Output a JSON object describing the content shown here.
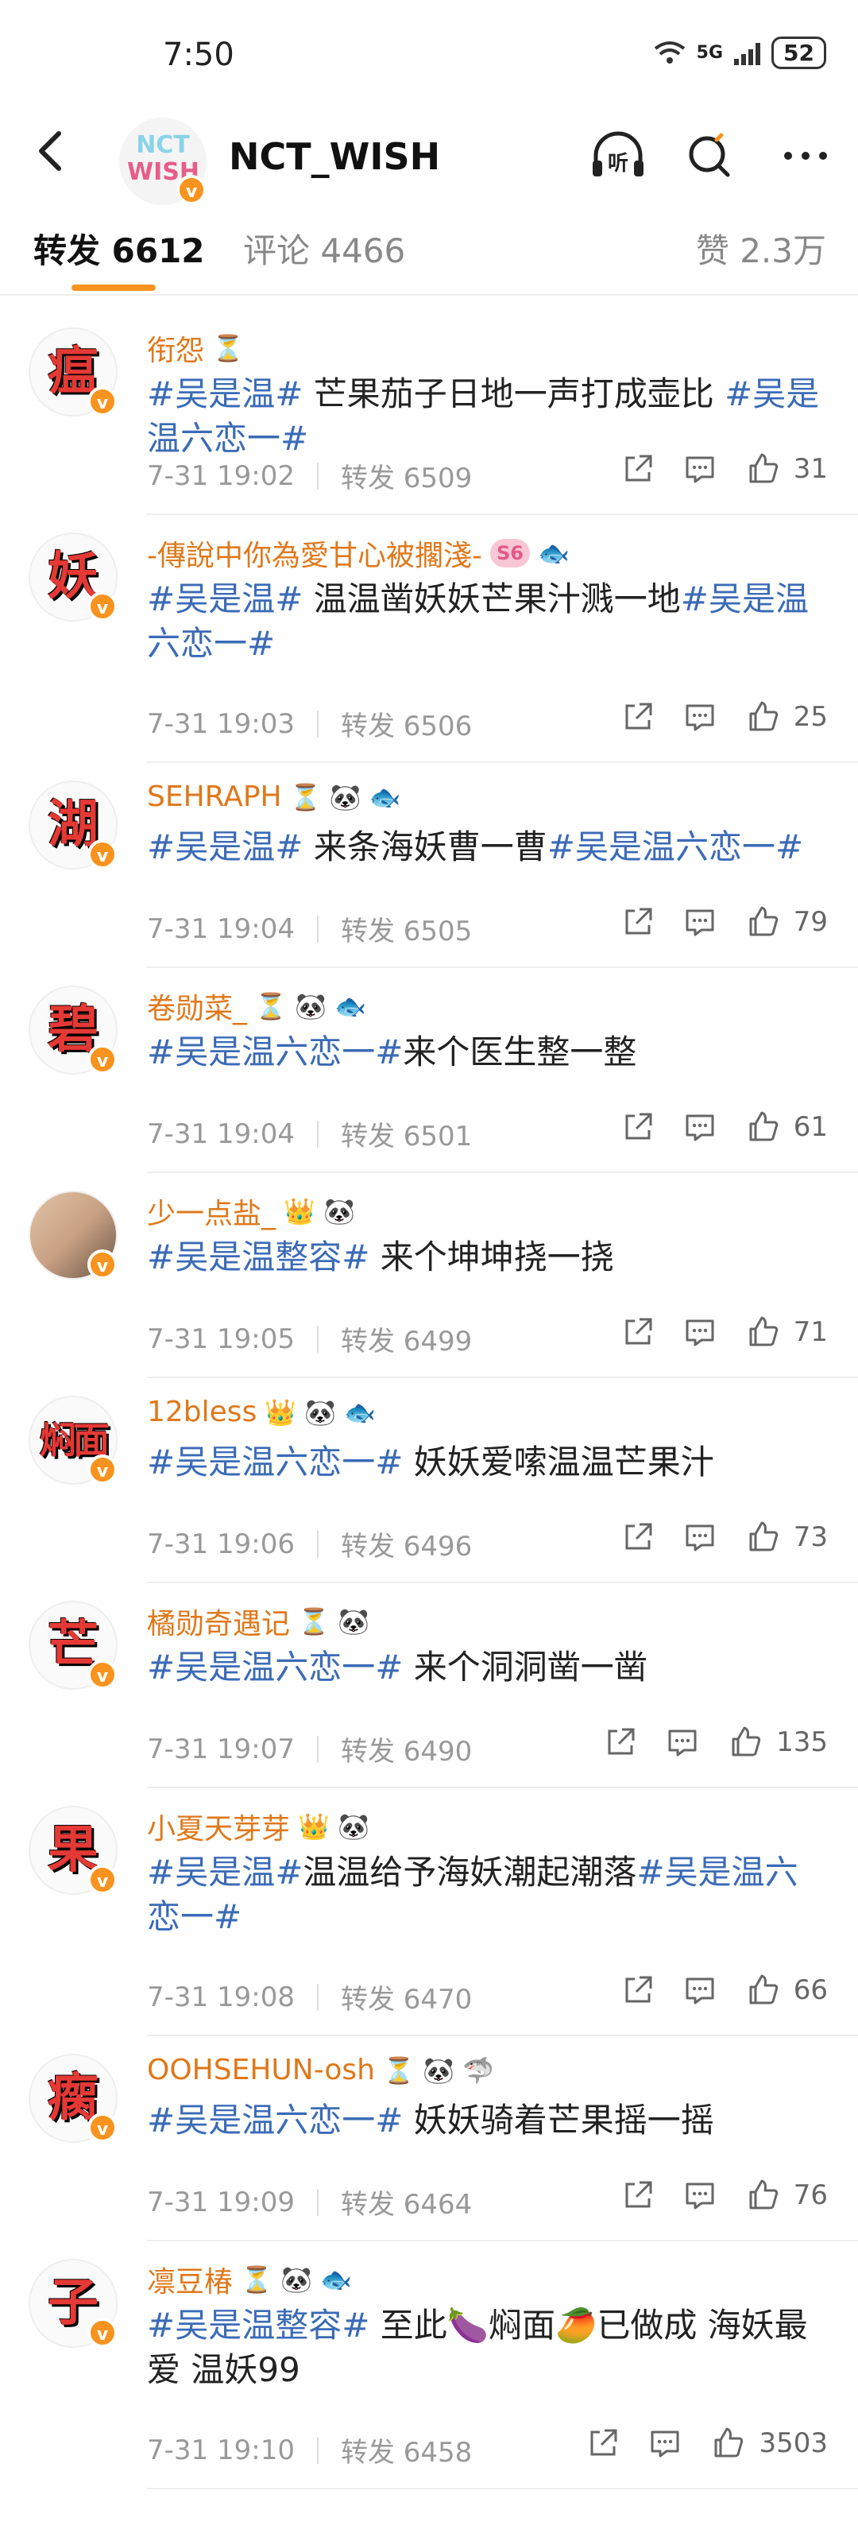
{
  "status": {
    "time": "7:50",
    "network": "5G",
    "battery": "52"
  },
  "header": {
    "title": "NCT_WISH",
    "logo_text_top": "NCT",
    "logo_text_bottom": "WISH",
    "back_icon": "chevron-left-icon",
    "listen_icon": "headphones-icon",
    "listen_label": "听",
    "search_icon": "search-icon",
    "more_icon": "more-icon"
  },
  "tabs": [
    {
      "label": "转发 6612",
      "active": true
    },
    {
      "label": "评论 4466",
      "active": false
    },
    {
      "label": "赞 2.3万",
      "active": false
    }
  ],
  "accent_color": "#f7931e",
  "hashtag_color": "#3b6bb7",
  "username_color": "#e0781a",
  "comments": [
    {
      "avatar": "瘟",
      "name": "衔怨",
      "badges": "⏳",
      "parts": [
        [
          "#吴是温#",
          1
        ],
        [
          " 芒果茄子日地一声打成壶比 ",
          0
        ],
        [
          "#吴是温六恋一#",
          1
        ]
      ],
      "time": "7-31 19:02",
      "repost": "转发 6509",
      "likes": "31"
    },
    {
      "avatar": "妖",
      "name": "-傳說中你為愛甘心被擱淺-",
      "badges": "🐟",
      "badge_label": "S6",
      "parts": [
        [
          "#吴是温#",
          1
        ],
        [
          " 温温凿妖妖芒果汁溅一地",
          0
        ],
        [
          "#吴是温六恋一#",
          1
        ]
      ],
      "time": "7-31 19:03",
      "repost": "转发 6506",
      "likes": "25"
    },
    {
      "avatar": "湖",
      "name": "SEHRAPH",
      "badges": "⏳ 🐼 🐟",
      "parts": [
        [
          "#吴是温#",
          1
        ],
        [
          " 来条海妖曹一曹",
          0
        ],
        [
          "#吴是温六恋一#",
          1
        ]
      ],
      "time": "7-31 19:04",
      "repost": "转发 6505",
      "likes": "79"
    },
    {
      "avatar": "碧",
      "name": "卷勋菜_",
      "badges": "⏳ 🐼 🐟",
      "parts": [
        [
          "#吴是温六恋一#",
          1
        ],
        [
          "来个医生整一整",
          0
        ]
      ],
      "time": "7-31 19:04",
      "repost": "转发 6501",
      "likes": "61"
    },
    {
      "avatar": "",
      "photo": true,
      "name": "少一点盐_",
      "badges": "👑 🐼",
      "parts": [
        [
          "#吴是温整容#",
          1
        ],
        [
          " 来个坤坤挠一挠",
          0
        ]
      ],
      "time": "7-31 19:05",
      "repost": "转发 6499",
      "likes": "71"
    },
    {
      "avatar": "焖面",
      "name": "12bless",
      "badges": "👑 🐼 🐟",
      "parts": [
        [
          "#吴是温六恋一#",
          1
        ],
        [
          " 妖妖爱嗦温温芒果汁",
          0
        ]
      ],
      "time": "7-31 19:06",
      "repost": "转发 6496",
      "likes": "73"
    },
    {
      "avatar": "芒",
      "name": "橘勋奇遇记",
      "badges": "⏳ 🐼",
      "parts": [
        [
          "#吴是温六恋一#",
          1
        ],
        [
          " 来个洞洞凿一凿",
          0
        ]
      ],
      "time": "7-31 19:07",
      "repost": "转发 6490",
      "likes": "135"
    },
    {
      "avatar": "果",
      "name": "小夏天芽芽",
      "badges": "👑 🐼",
      "parts": [
        [
          "#吴是温#",
          1
        ],
        [
          "温温给予海妖潮起潮落",
          0
        ],
        [
          "#吴是温六恋一#",
          1
        ]
      ],
      "time": "7-31 19:08",
      "repost": "转发 6470",
      "likes": "66"
    },
    {
      "avatar": "瘸",
      "name": "OOHSEHUN-osh",
      "badges": "⏳ 🐼 🦈",
      "parts": [
        [
          "#吴是温六恋一#",
          1
        ],
        [
          " 妖妖骑着芒果摇一摇",
          0
        ]
      ],
      "time": "7-31 19:09",
      "repost": "转发 6464",
      "likes": "76"
    },
    {
      "avatar": "子",
      "name": "凛豆椿",
      "badges": "⏳ 🐼 🐟",
      "parts": [
        [
          "#吴是温整容#",
          1
        ],
        [
          " 至此🍆焖面🥭已做成 海妖最爱 温妖99",
          0
        ]
      ],
      "time": "7-31 19:10",
      "repost": "转发 6458",
      "likes": "3503"
    }
  ]
}
